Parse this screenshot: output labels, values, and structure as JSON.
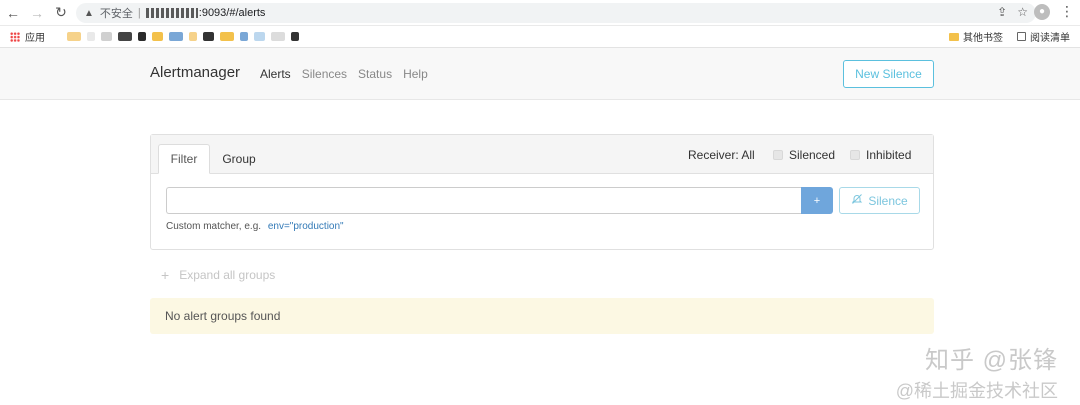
{
  "browser": {
    "back_icon": "←",
    "forward_icon": "→",
    "reload_icon": "↻",
    "warning_icon": "▲",
    "insecure_label": "不安全",
    "url_separator": "|",
    "url_visible": ":9093/#/alerts",
    "share_icon": "⇪",
    "star_icon": "☆",
    "avatar_icon": "●",
    "menu_icon": "⋮"
  },
  "bookmarks": {
    "apps_label": "应用",
    "blurred_colors": [
      "#f6d28a",
      "#e9e9e9",
      "#d0d0d0",
      "#444444",
      "#2b2b2b",
      "#f3c14b",
      "#7aa7d6",
      "#f6d28a",
      "#333333",
      "#f3c14b",
      "#7aa7d6",
      "#bcd7ee",
      "#dcdcdc",
      "#333333"
    ],
    "folder_label": "其他书签",
    "reading_list_label": "阅读清单"
  },
  "navbar": {
    "brand": "Alertmanager",
    "links": [
      "Alerts",
      "Silences",
      "Status",
      "Help"
    ],
    "new_silence_label": "New Silence"
  },
  "filter_panel": {
    "tab_filter": "Filter",
    "tab_group": "Group",
    "receiver_label": "Receiver: All",
    "silenced_label": "Silenced",
    "inhibited_label": "Inhibited",
    "input_value": "",
    "plus_label": "+",
    "silence_icon": "🔕",
    "silence_label": "Silence",
    "hint_text": "Custom matcher, e.g.",
    "hint_example": "env=\"production\""
  },
  "expand": {
    "plus_icon": "+",
    "label": "Expand all groups"
  },
  "empty_state": {
    "message": "No alert groups found"
  },
  "watermark": {
    "line1": "知乎 @张锋",
    "line2": "@稀土掘金技术社区"
  },
  "colors": {
    "accent_info": "#5bc0de",
    "primary_blue": "#6fa6dc",
    "warning_bg": "#fcf8e3",
    "navbar_bg": "#f8f8f8"
  }
}
